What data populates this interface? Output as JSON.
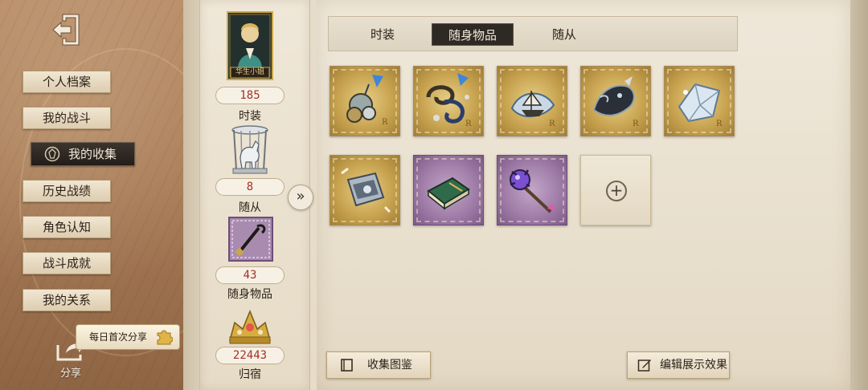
{
  "nav": {
    "items": [
      {
        "label": "个人档案"
      },
      {
        "label": "我的战斗"
      },
      {
        "label": "我的收集"
      },
      {
        "label": "历史战绩"
      },
      {
        "label": "角色认知"
      },
      {
        "label": "战斗成就"
      },
      {
        "label": "我的关系"
      }
    ],
    "active_index": 2,
    "exit_icon": "exit-door-icon"
  },
  "share": {
    "tip": "每日首次分享",
    "label": "分享"
  },
  "stats": [
    {
      "count": "185",
      "label": "时装",
      "thumb_caption": "华生小姐"
    },
    {
      "count": "8",
      "label": "随从"
    },
    {
      "count": "43",
      "label": "随身物品"
    },
    {
      "count": "22443",
      "label": "归宿"
    }
  ],
  "expand_icon": "»",
  "tabs": [
    {
      "label": "时装"
    },
    {
      "label": "随身物品"
    },
    {
      "label": "随从"
    }
  ],
  "active_tab": 1,
  "items": [
    {
      "rarity": "gold",
      "icon": "pendant-item-icon"
    },
    {
      "rarity": "gold",
      "icon": "chain-item-icon"
    },
    {
      "rarity": "gold",
      "icon": "ship-item-icon"
    },
    {
      "rarity": "gold",
      "icon": "dark-creature-item-icon"
    },
    {
      "rarity": "gold",
      "icon": "crystal-item-icon"
    },
    {
      "rarity": "gold",
      "icon": "box-item-icon"
    },
    {
      "rarity": "purple",
      "icon": "book-item-icon"
    },
    {
      "rarity": "purple",
      "icon": "scepter-item-icon"
    },
    {
      "rarity": "empty",
      "icon": "plus-icon"
    }
  ],
  "buttons": {
    "collection_guide": "收集图鉴",
    "edit_display": "编辑展示效果"
  },
  "colors": {
    "count_red": "#a3322a",
    "gold_frame": "#c8a451",
    "purple_frame": "#9d7aa5",
    "active_dark": "#2f2925"
  }
}
